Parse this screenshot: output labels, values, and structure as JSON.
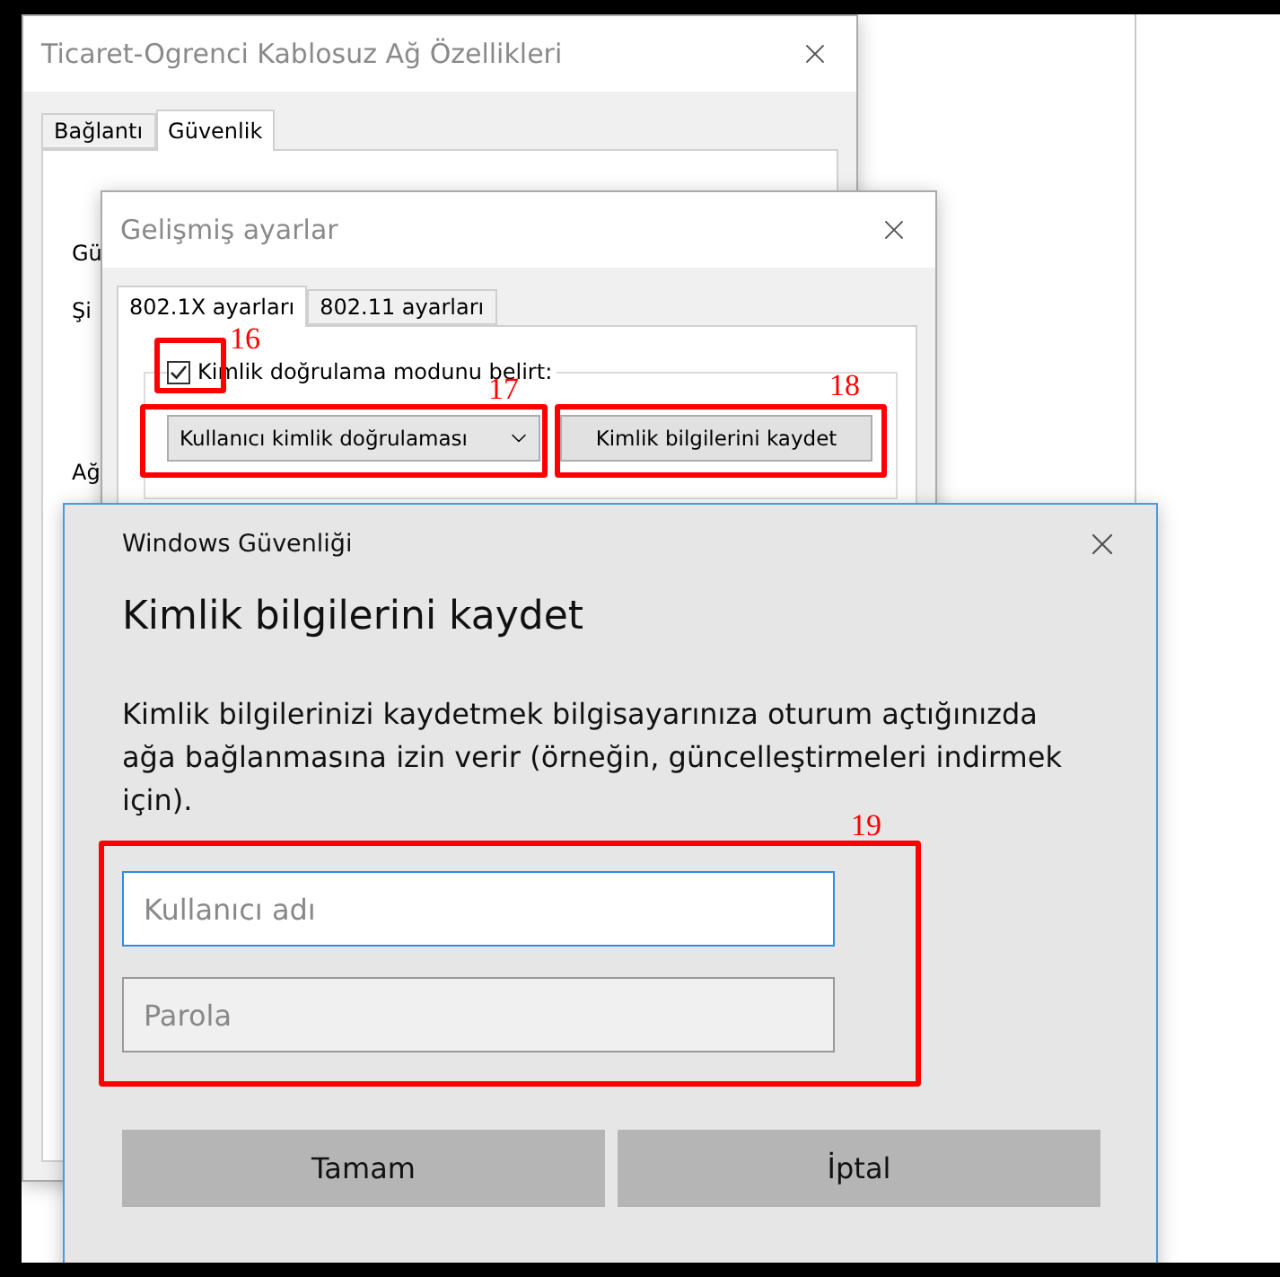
{
  "properties_window": {
    "title": "Ticaret-Ogrenci Kablosuz Ağ Özellikleri",
    "tabs": [
      {
        "label": "Bağlantı",
        "selected": false
      },
      {
        "label": "Güvenlik",
        "selected": true
      }
    ],
    "labels": [
      "Gü",
      "Şi",
      "Ağ"
    ]
  },
  "advanced_window": {
    "title": "Gelişmiş ayarlar",
    "tabs": [
      {
        "label": "802.1X ayarları",
        "selected": true
      },
      {
        "label": "802.11 ayarları",
        "selected": false
      }
    ],
    "auth_mode_checkbox": {
      "label": "Kimlik doğrulama modunu belirt:",
      "checked": true
    },
    "auth_dropdown": {
      "value": "Kullanıcı kimlik doğrulaması"
    },
    "save_button": "Kimlik bilgilerini kaydet"
  },
  "security_dialog": {
    "app_title": "Windows Güvenliği",
    "heading": "Kimlik bilgilerini kaydet",
    "description": "Kimlik bilgilerinizi kaydetmek bilgisayarınıza oturum açtığınızda ağa bağlanmasına izin verir (örneğin, güncelleştirmeleri indirmek için).",
    "fields": [
      {
        "placeholder": "Kullanıcı adı",
        "focused": true
      },
      {
        "placeholder": "Parola",
        "focused": false
      }
    ],
    "buttons": [
      "Tamam",
      "İptal"
    ]
  },
  "annotations": [
    {
      "number": "16"
    },
    {
      "number": "17"
    },
    {
      "number": "18"
    },
    {
      "number": "19"
    }
  ]
}
